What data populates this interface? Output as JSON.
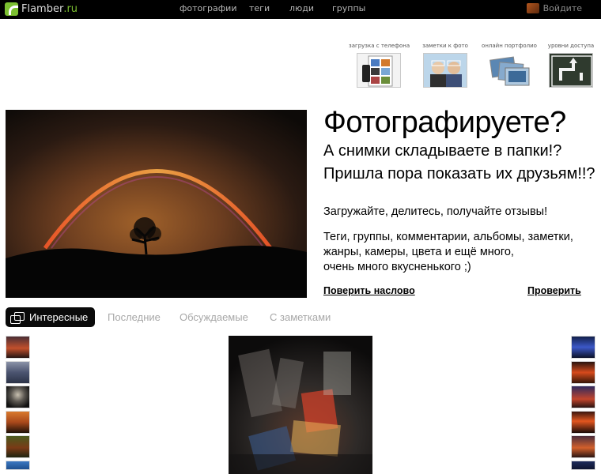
{
  "topbar": {
    "logo_text": "Flamber",
    "logo_tld": ".ru",
    "nav": [
      "фотографии",
      "теги",
      "люди",
      "группы"
    ],
    "login": "Войдите"
  },
  "features": [
    {
      "label": "загрузка с телефона"
    },
    {
      "label": "заметки к фото"
    },
    {
      "label": "онлайн портфолио"
    },
    {
      "label": "уровни доступа"
    }
  ],
  "pitch": {
    "headline": "Фотографируете?",
    "line2": "А снимки складываете в папки!?",
    "line3": "Пришла пора показать их друзьям!!?",
    "para1": "Загружайте, делитесь, получайте отзывы!",
    "para2_lines": [
      "Теги, группы, комментарии, альбомы, заметки,",
      "жанры, камеры, цвета и ещё много,",
      "очень много вкусненького ;)"
    ],
    "link_trust": "Поверить наслово",
    "link_check": "Проверить"
  },
  "tabs": {
    "active": "Интересные",
    "items": [
      "Последние",
      "Обсуждаемые",
      "С заметками"
    ]
  },
  "colors": {
    "brand_green": "#7cc031",
    "topbar_bg": "#000000",
    "tab_inactive": "#a8a8a8"
  }
}
